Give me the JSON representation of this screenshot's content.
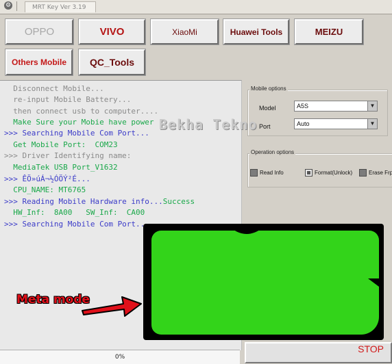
{
  "window": {
    "title": "MRT Key Ver 3.19"
  },
  "brands": {
    "oppo": "OPPO",
    "vivo": "VIVO",
    "xiaomi": "XiaoMi",
    "huawei": "Huawei Tools",
    "meizu": "MEIZU",
    "others": "Others Mobile",
    "qc": "QC_Tools"
  },
  "log": [
    {
      "text": "  Disconnect Mobile...",
      "color": "gray"
    },
    {
      "text": "  re-input Mobile Battery...",
      "color": "gray"
    },
    {
      "text": "  then connect usb to computer....",
      "color": "gray"
    },
    {
      "text": "  Make Sure your Mobie have power",
      "color": "green"
    },
    {
      "text": ">>> Searching Mobile Com Port...",
      "color": "blue"
    },
    {
      "text": "  Get Mobile Port:  COM23",
      "color": "green"
    },
    {
      "text": ">>> Driver Identifying name:",
      "color": "gray"
    },
    {
      "text": "  MediaTek USB Port_V1632",
      "color": "green"
    },
    {
      "text": ">>> ÊÖ»úÁ¬½ÓÖÝ²É...",
      "color": "blue"
    },
    {
      "text": "  CPU_NAME: MT6765",
      "color": "green"
    },
    {
      "text": ">>> Reading Mobile Hardware info...",
      "color": "blue",
      "suffix": "Success"
    },
    {
      "text": "  HW_Inf:  8A00   SW_Inf:  CA00",
      "color": "green"
    },
    {
      "text": ">>> Searching Mobile Com Port...",
      "color": "blue"
    }
  ],
  "mobile_options": {
    "title": "Mobile options",
    "model_label": "Model",
    "model_value": "A5S",
    "port_label": "Port",
    "port_value": "Auto"
  },
  "operation_options": {
    "title": "Operation options",
    "read_info": "Read Info",
    "format": "Format(Unlock)",
    "erase": "Erase Frp"
  },
  "progress": {
    "value": "0%"
  },
  "stop_label": "STOP",
  "watermark": "Bekha Tekno",
  "annotation": "Meta mode",
  "colors": {
    "screen": "#33d41a",
    "accent_red": "#b41414",
    "stop_red": "#d01818"
  }
}
